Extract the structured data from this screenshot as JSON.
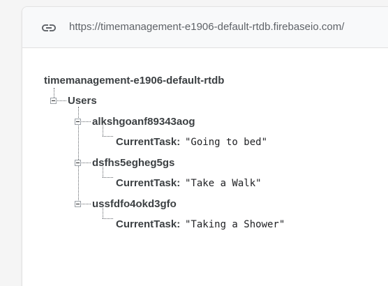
{
  "url_bar": {
    "icon": "link-icon",
    "url": "https://timemanagement-e1906-default-rtdb.firebaseio.com/"
  },
  "tree": {
    "root": "timemanagement-e1906-default-rtdb",
    "users_key": "Users",
    "users": [
      {
        "key": "alkshgoanf89343aog",
        "field_key": "CurrentTask:",
        "field_value": "\"Going to bed\""
      },
      {
        "key": "dsfhs5egheg5gs",
        "field_key": "CurrentTask:",
        "field_value": "\"Take a Walk\""
      },
      {
        "key": "ussfdfo4okd3gfo",
        "field_key": "CurrentTask:",
        "field_value": "\"Taking a Shower\""
      }
    ]
  }
}
